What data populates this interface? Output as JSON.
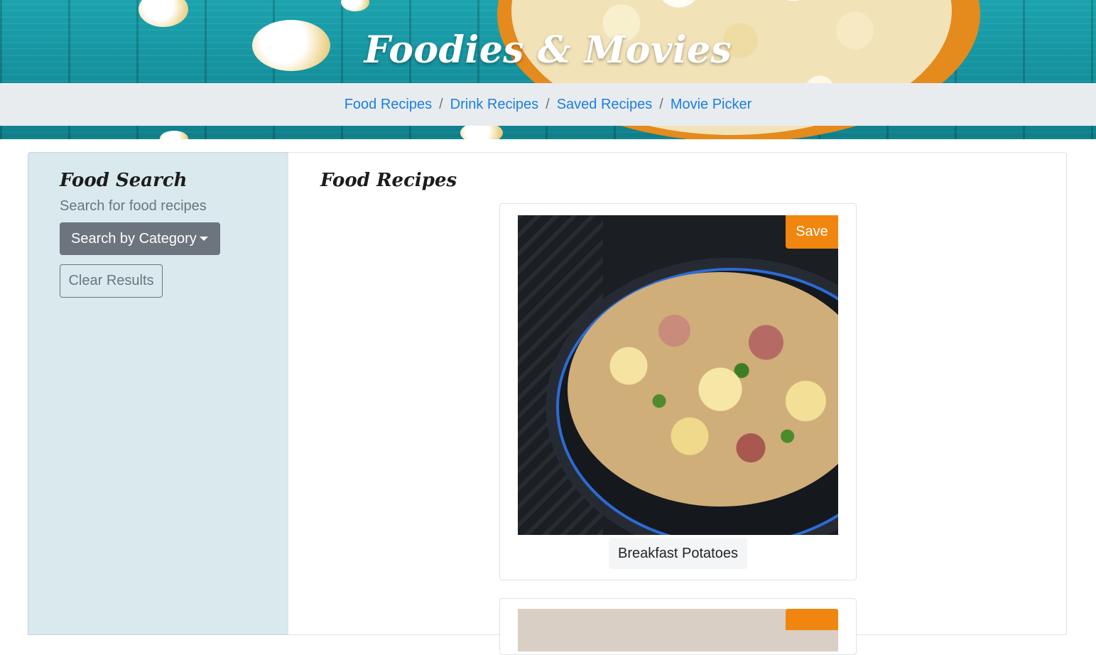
{
  "header": {
    "title": "Foodies & Movies",
    "nav": [
      {
        "label": "Food Recipes"
      },
      {
        "label": "Drink Recipes"
      },
      {
        "label": "Saved Recipes"
      },
      {
        "label": "Movie Picker"
      }
    ],
    "separator": "/"
  },
  "sidebar": {
    "title": "Food Search",
    "subtitle": "Search for food recipes",
    "category_button": "Search by Category",
    "clear_button": "Clear Results"
  },
  "main": {
    "title": "Food Recipes",
    "cards": [
      {
        "name": "Breakfast Potatoes",
        "save_label": "Save"
      },
      {
        "name": "",
        "save_label": ""
      }
    ]
  },
  "colors": {
    "accent_orange": "#f0860f",
    "link_blue": "#1a7fe0",
    "sidebar_bg": "#d9e9ee",
    "secondary_gray": "#6c757d"
  }
}
